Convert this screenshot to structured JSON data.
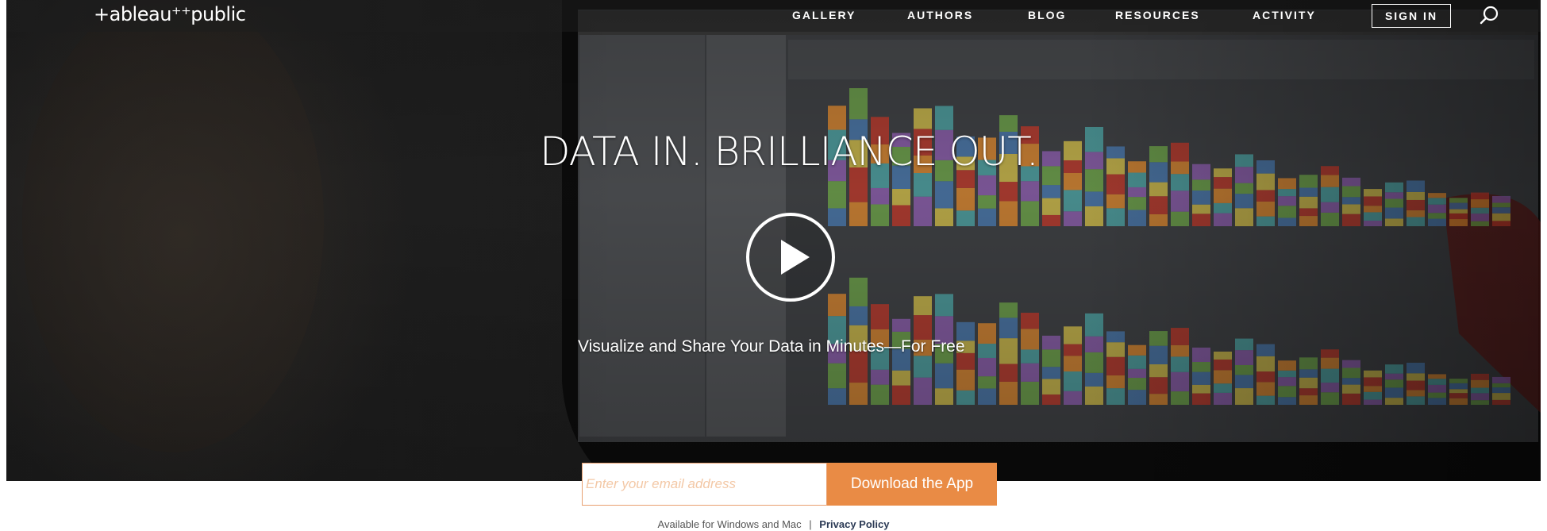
{
  "brand": {
    "logo_text": "+ableau⁺⁺public",
    "accent_color": "#e98b45"
  },
  "nav": {
    "items": [
      {
        "label": "GALLERY"
      },
      {
        "label": "AUTHORS"
      },
      {
        "label": "BLOG"
      },
      {
        "label": "RESOURCES"
      },
      {
        "label": "ACTIVITY"
      }
    ],
    "signin_label": "SIGN IN",
    "search_icon": "search-icon"
  },
  "hero": {
    "headline": "DATA IN. BRILLIANCE OUT.",
    "subheadline": "Visualize and Share Your Data in Minutes—For Free",
    "play_icon": "play-icon"
  },
  "signup": {
    "email_placeholder": "Enter your email address",
    "download_label": "Download the App",
    "availability_text": "Available for Windows and Mac",
    "separator": "|",
    "privacy_label": "Privacy Policy"
  }
}
